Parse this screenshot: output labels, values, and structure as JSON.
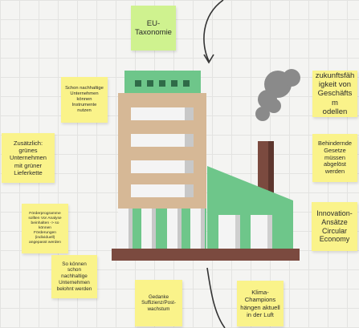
{
  "board": {
    "notes": [
      {
        "id": "eu-taxonomie",
        "text": "EU-\nTaxonomie",
        "color": "#cff28f"
      },
      {
        "id": "schon-nachhaltige",
        "text": "Schon nachhaltige\nUnternehmen\nkönnen\nInstrumente\nnutzen",
        "color": "#faf38a"
      },
      {
        "id": "zukunftsfaehigkeit",
        "text": "zukunftsfäh\nigkeit von\nGeschäftsm\nodellen",
        "color": "#faf38a"
      },
      {
        "id": "zusaetzlich",
        "text": "Zusätzlich:\ngrünes\nUnternehmen\nmit grüner\nLieferkette",
        "color": "#faf38a"
      },
      {
        "id": "behindernde-gesetze",
        "text": "Behindernde\nGesetze\nmüssen\nabgelöst\nwerden",
        "color": "#faf38a"
      },
      {
        "id": "foerderprogramme",
        "text": "Förderprogramme\nsollten Vor Analyse\nbeinhalten -> so\nkönnen\nFörderungen\n(individuell)\nangepasst werden",
        "color": "#faf38a"
      },
      {
        "id": "innovation-ansaetze",
        "text": "Innovation-\nAnsätze\nCircular\nEconomy",
        "color": "#faf38a"
      },
      {
        "id": "so-koennen",
        "text": "So können\nschon\nnachhaltige\nUnternehmen\nbelohnt werden",
        "color": "#faf38a"
      },
      {
        "id": "gedanke-suffizienz",
        "text": "Gedanke\nSuffizienz/Post-\nwachstum",
        "color": "#faf38a"
      },
      {
        "id": "klima-champions",
        "text": "Klima-\nChampions\nhängen aktuell\nin der Luft",
        "color": "#faf38a"
      }
    ]
  },
  "illustration": {
    "name": "factory-illustration",
    "colors": {
      "green": "#6ec68a",
      "darkGreen": "#2f6b48",
      "tan": "#d6b896",
      "window": "#f4f4f4",
      "pillar": "#c8c8c8",
      "brown": "#7b4a3f",
      "smoke": "#8a8a8a",
      "arrow": "#333333"
    }
  }
}
